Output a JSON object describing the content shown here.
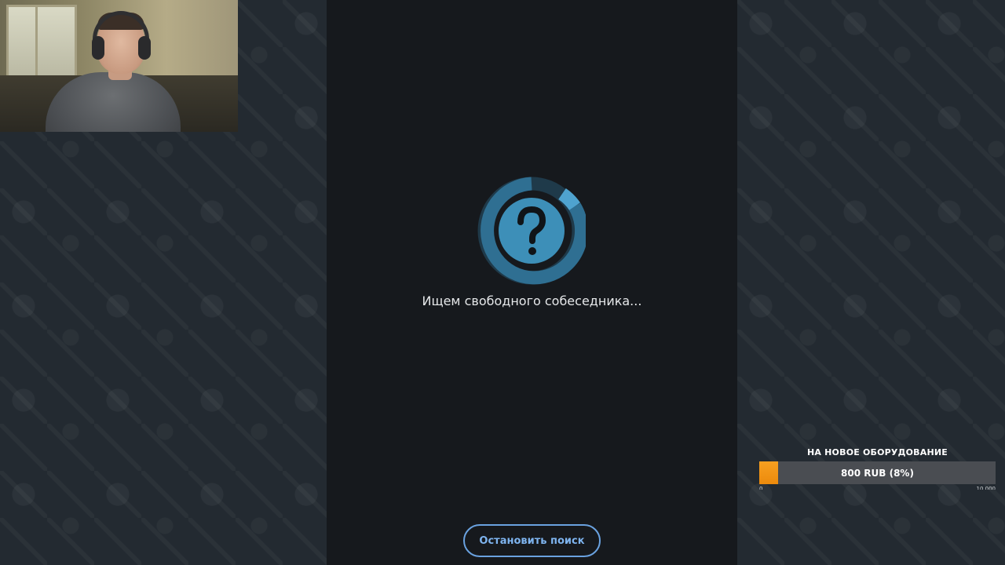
{
  "search": {
    "status_text": "Ищем свободного собеседника...",
    "stop_button_label": "Остановить поиск",
    "icon": "question-mark-icon",
    "accent_color": "#3d8fb8"
  },
  "goal_widget": {
    "title": "НА НОВОЕ ОБОРУДОВАНИЕ",
    "progress_label": "800 RUB (8%)",
    "progress_fraction": 0.08,
    "min_label": "0",
    "max_label": "10 000",
    "fill_color": "#f39515"
  },
  "webcam": {
    "visible": true
  }
}
